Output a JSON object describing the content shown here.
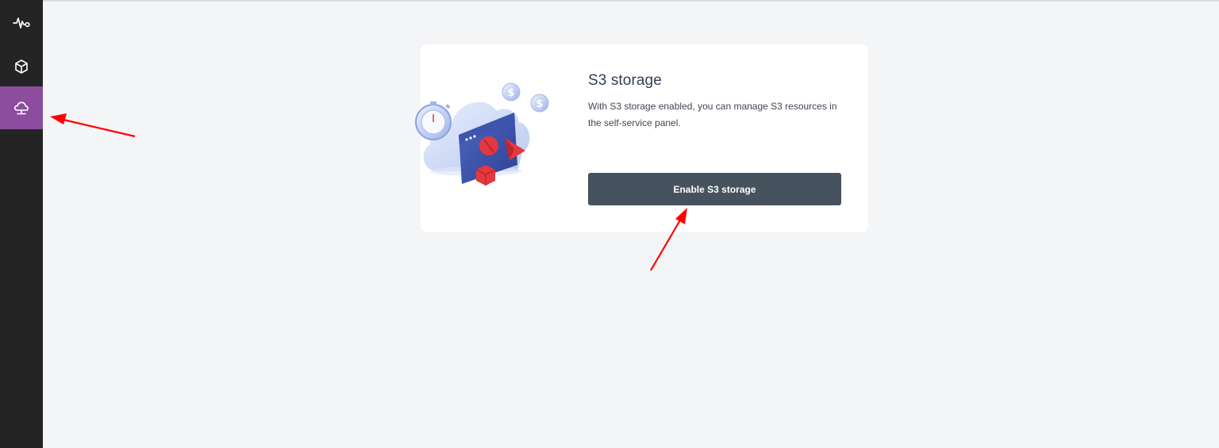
{
  "sidebar": {
    "items": [
      {
        "icon": "activity-icon",
        "active": false
      },
      {
        "icon": "cube-icon",
        "active": false
      },
      {
        "icon": "cloud-storage-icon",
        "active": true
      }
    ],
    "background": "#242424",
    "active_background": "#8c4d9f"
  },
  "card": {
    "title": "S3 storage",
    "description": "With S3 storage enabled, you can manage S3 resources in the self-service panel.",
    "enable_button_label": "Enable S3 storage",
    "illustration_icon": "cloud-s3-illustration"
  },
  "annotations": {
    "arrow_color": "#ff0000",
    "arrows": [
      "arrow-to-cloud-storage-nav",
      "arrow-to-enable-button"
    ]
  },
  "colors": {
    "page_background": "#f4f5f7",
    "button_background": "#46525e"
  }
}
